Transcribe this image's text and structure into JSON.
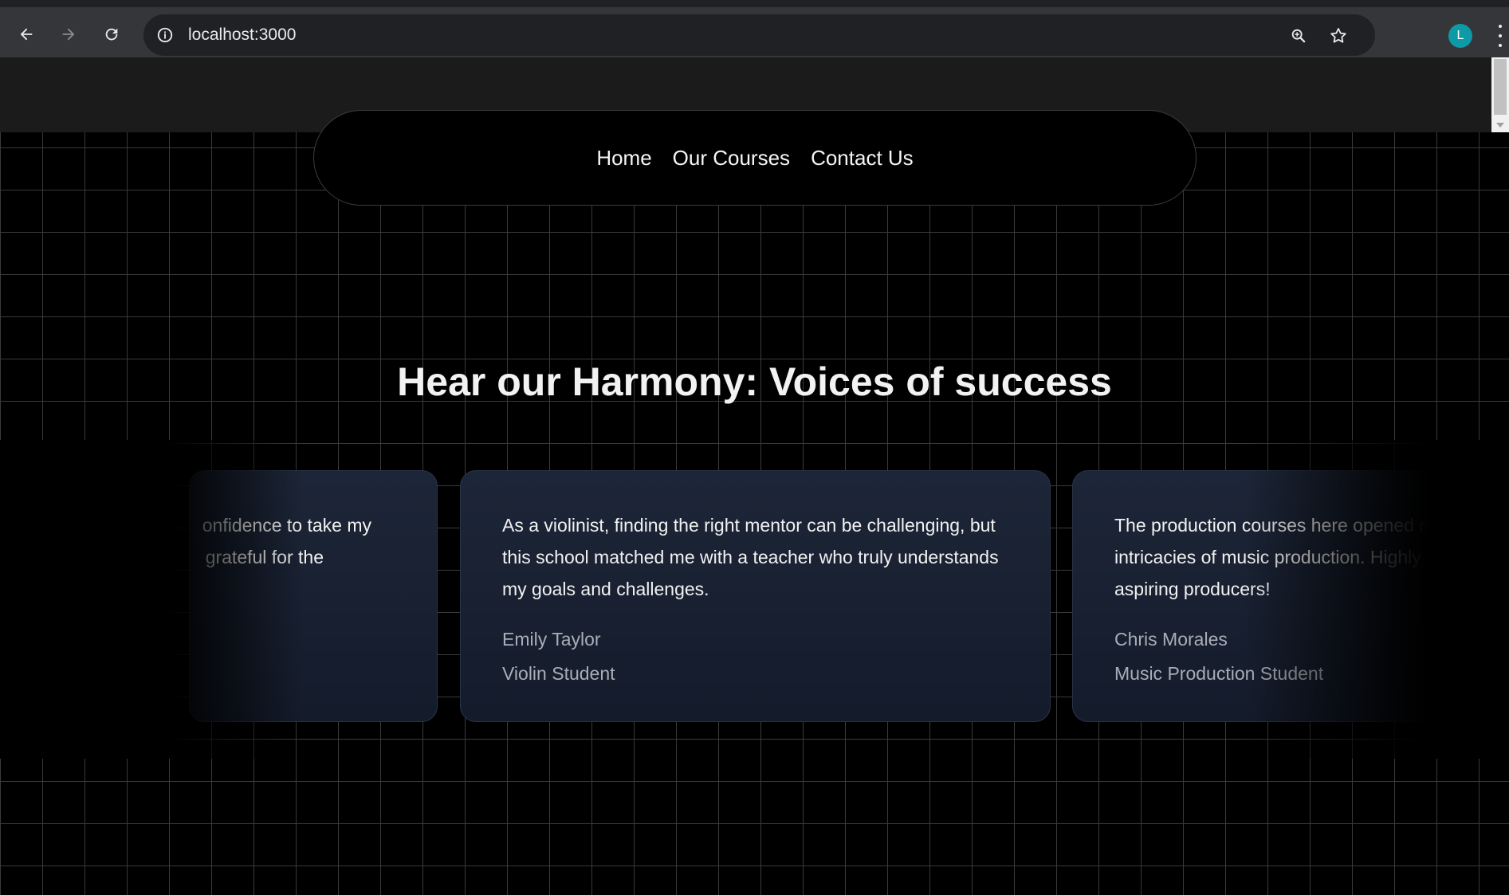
{
  "browser": {
    "url": "localhost:3000",
    "avatar_letter": "L",
    "avatar_color": "#0d9aa6"
  },
  "nav": {
    "links": [
      {
        "label": "Home"
      },
      {
        "label": "Our Courses"
      },
      {
        "label": "Contact Us"
      }
    ]
  },
  "testimonials": {
    "heading": "Hear our Harmony: Voices of success",
    "cards": [
      {
        "quote_lines": [
          "onfidence to take my",
          "grateful for the"
        ],
        "name": "",
        "role": ""
      },
      {
        "quote_lines": [
          "As a violinist, finding the right mentor can be challenging, but",
          "this school matched me with a teacher who truly understands",
          "my goals and challenges."
        ],
        "name": "Emily Taylor",
        "role": "Violin Student"
      },
      {
        "quote_lines": [
          "The production courses here opened my e",
          "intricacies of music production. Highly reco",
          "aspiring producers!"
        ],
        "name": "Chris Morales",
        "role": "Music Production Student"
      }
    ]
  }
}
